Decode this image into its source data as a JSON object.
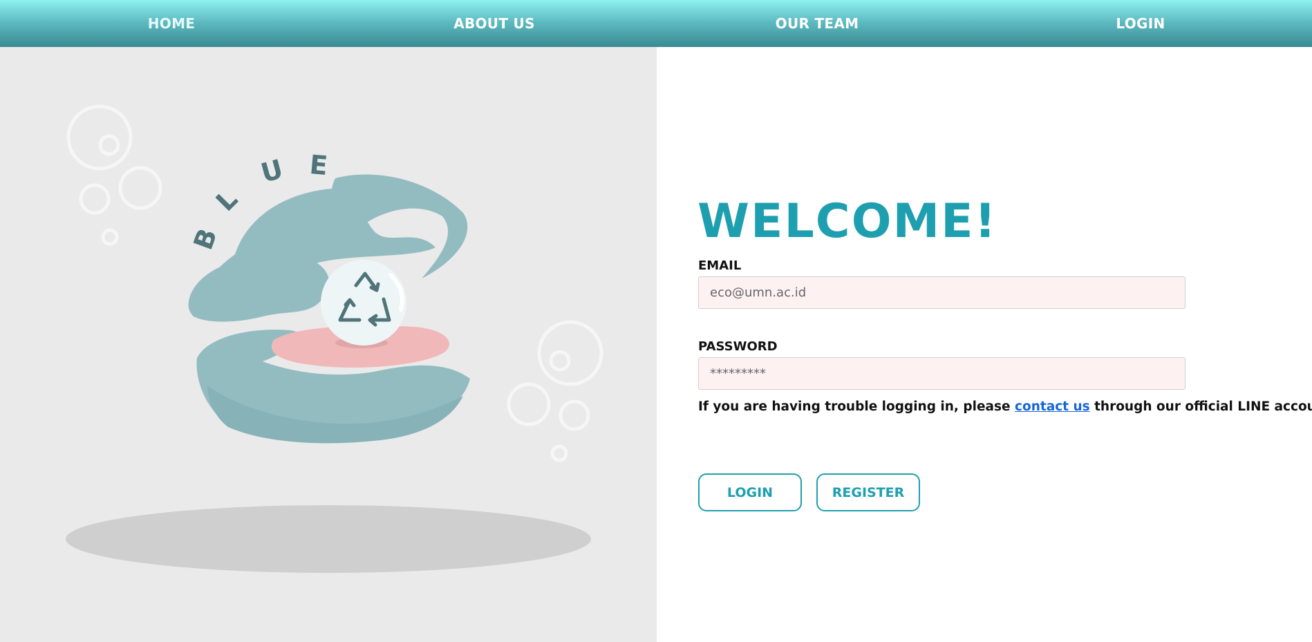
{
  "nav": {
    "items": [
      {
        "label": "HOME"
      },
      {
        "label": "ABOUT US"
      },
      {
        "label": "OUR TEAM"
      },
      {
        "label": "LOGIN"
      }
    ]
  },
  "illustration": {
    "letters": [
      "B",
      "L",
      "U",
      "E"
    ],
    "icon": "recycle-icon",
    "colors": {
      "shell": "#93bcc1",
      "pearl": "#eef5f6",
      "tongue": "#f0b8b8",
      "letters": "#4f7479",
      "shadow": "#cfcfcf",
      "bubble": "#f7f7f7"
    }
  },
  "form": {
    "title": "WELCOME!",
    "email_label": "EMAIL",
    "email_placeholder": "eco@umn.ac.id",
    "password_label": "PASSWORD",
    "password_placeholder": "*********",
    "help_prefix": "If you are having trouble logging in, please ",
    "help_link": "contact us",
    "help_suffix": " through our official LINE account.",
    "login_button": "LOGIN",
    "register_button": "REGISTER"
  },
  "colors": {
    "accent": "#1e9fb0",
    "link": "#1565d8",
    "input_bg": "#fdf2f1",
    "nav_top": "#8ef2f2",
    "nav_bottom": "#3a8a92"
  }
}
